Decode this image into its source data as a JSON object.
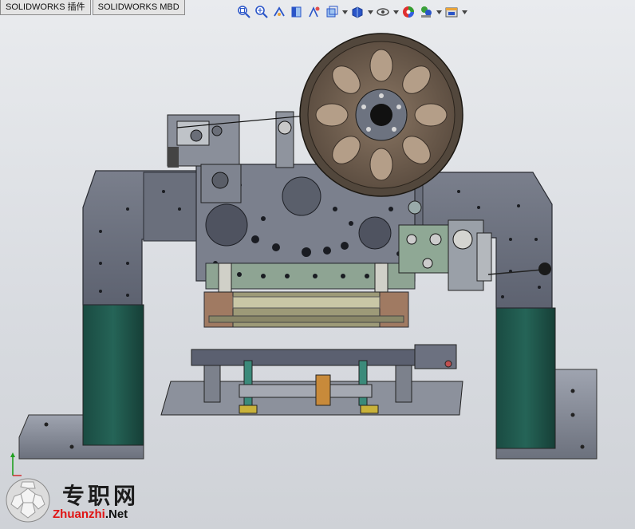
{
  "tabs": [
    {
      "label": "SOLIDWORKS 插件"
    },
    {
      "label": "SOLIDWORKS MBD"
    }
  ],
  "toolbar": {
    "icons": [
      "zoom-to-fit-icon",
      "zoom-to-area-icon",
      "previous-view-icon",
      "section-view-icon",
      "dynamic-annotation-icon",
      "view-orientation-icon",
      "display-style-icon",
      "hide-show-items-icon",
      "edit-appearance-icon",
      "apply-scene-icon",
      "view-settings-icon"
    ]
  },
  "watermark": {
    "cn": "专职网",
    "en_red": "Zhuanzhi",
    "en_black": ".Net"
  },
  "colors": {
    "frame_gray": "#6e7380",
    "teal": "#1f5a4e",
    "wheel_brown": "#6b5a4a",
    "bracket_green": "#7f9a86",
    "blue_accent": "#2a55c8"
  }
}
